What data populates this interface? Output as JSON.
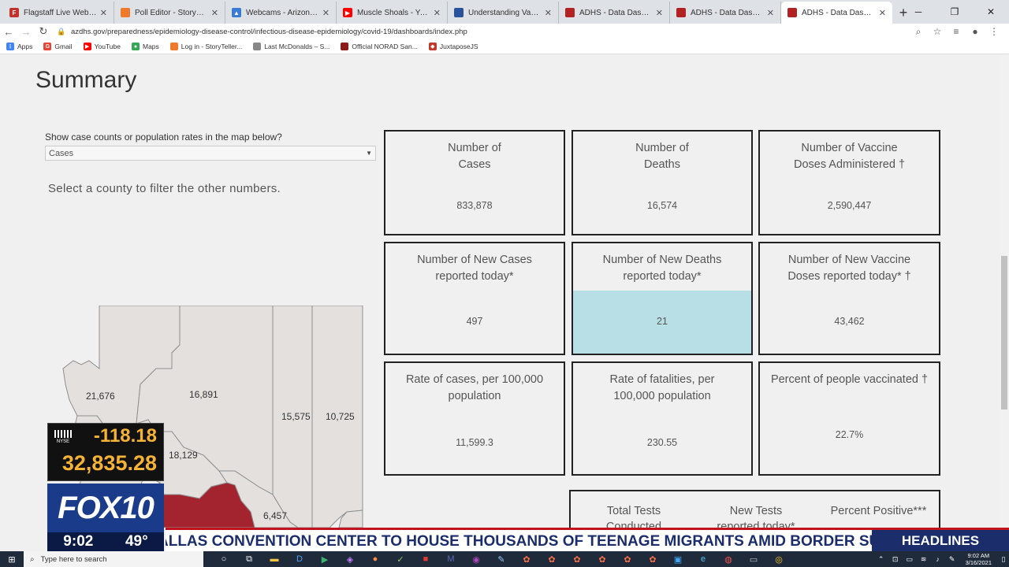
{
  "browser": {
    "tabs": [
      {
        "label": "Flagstaff Live Webcams - D",
        "icon_color": "#c4302b",
        "icon_text": "F"
      },
      {
        "label": "Poll Editor - StoryTeller Poll",
        "icon_color": "#f07a2b",
        "icon_text": ""
      },
      {
        "label": "Webcams - Arizona Snowb",
        "icon_color": "#3a7bd5",
        "icon_text": "▲"
      },
      {
        "label": "Muscle Shoals - YouTube",
        "icon_color": "#ff0000",
        "icon_text": "▶"
      },
      {
        "label": "Understanding Vaccination",
        "icon_color": "#2a5298",
        "icon_text": ""
      },
      {
        "label": "ADHS - Data Dashboard",
        "icon_color": "#b22222",
        "icon_text": ""
      },
      {
        "label": "ADHS - Data Dashboard",
        "icon_color": "#b22222",
        "icon_text": ""
      },
      {
        "label": "ADHS - Data Dashboard",
        "icon_color": "#b22222",
        "icon_text": "",
        "active": true
      }
    ],
    "url": "azdhs.gov/preparedness/epidemiology-disease-control/infectious-disease-epidemiology/covid-19/dashboards/index.php",
    "bookmarks": [
      {
        "label": "Apps",
        "icon_color": "#4285f4",
        "icon_text": "⋮"
      },
      {
        "label": "Gmail",
        "icon_color": "#ea4335",
        "icon_text": "G"
      },
      {
        "label": "YouTube",
        "icon_color": "#ff0000",
        "icon_text": "▶"
      },
      {
        "label": "Maps",
        "icon_color": "#34a853",
        "icon_text": "●"
      },
      {
        "label": "Log in - StoryTeller...",
        "icon_color": "#f07a2b",
        "icon_text": ""
      },
      {
        "label": "Last McDonalds – S...",
        "icon_color": "#888888",
        "icon_text": ""
      },
      {
        "label": "Official NORAD San...",
        "icon_color": "#8b1a1a",
        "icon_text": ""
      },
      {
        "label": "JuxtaposeJS",
        "icon_color": "#c0392b",
        "icon_text": "◆"
      }
    ]
  },
  "page": {
    "title": "Summary",
    "filter_label": "Show case counts or population rates in the map below?",
    "filter_value": "Cases",
    "filter_hint": "Select a county to filter the other numbers."
  },
  "map": {
    "labels": [
      "21,676",
      "16,891",
      "15,575",
      "10,725",
      "18,129",
      "6,457"
    ]
  },
  "cards": [
    {
      "title_line1": "Number of",
      "title_line2": "Cases",
      "value": "833,878"
    },
    {
      "title_line1": "Number of",
      "title_line2": "Deaths",
      "value": "16,574"
    },
    {
      "title_line1": "Number of Vaccine",
      "title_line2": "Doses Administered †",
      "value": "2,590,447"
    },
    {
      "title_line1": "Number of New Cases",
      "title_line2": "reported today*",
      "value": "497"
    },
    {
      "title_line1": "Number of New Deaths",
      "title_line2": "reported today*",
      "value": "21"
    },
    {
      "title_line1": "Number of New Vaccine",
      "title_line2": "Doses reported today* †",
      "value": "43,462"
    },
    {
      "title_line1": "Rate of cases, per 100,000",
      "title_line2": "population",
      "value": "11,599.3"
    },
    {
      "title_line1": "Rate of fatalities, per",
      "title_line2": "100,000 population",
      "value": "230.55"
    },
    {
      "title_line1": "Percent of people vaccinated †",
      "title_line2": "",
      "value": "22.7%"
    }
  ],
  "tests": {
    "col1_line1": "Total Tests",
    "col1_line2": "Conducted",
    "col2_line1": "New Tests",
    "col2_line2": "reported today*",
    "col3_line1": "Percent Positive***"
  },
  "tv": {
    "exchange": "NYSE",
    "change": "-118.18",
    "index": "32,835.28",
    "station": "FOX10",
    "time": "9:02",
    "temp": "49°",
    "ticker": "ALLAS CONVENTION CENTER TO HOUSE THOUSANDS OF TEENAGE MIGRANTS AMID BORDER SURGE",
    "section": "HEADLINES"
  },
  "taskbar": {
    "search_placeholder": "Type here to search",
    "time": "9:02 AM",
    "date": "3/16/2021"
  },
  "colors": {
    "highlight": "#b8dfe6",
    "county_selected": "#a3232f",
    "county_default": "#e3e0de"
  }
}
